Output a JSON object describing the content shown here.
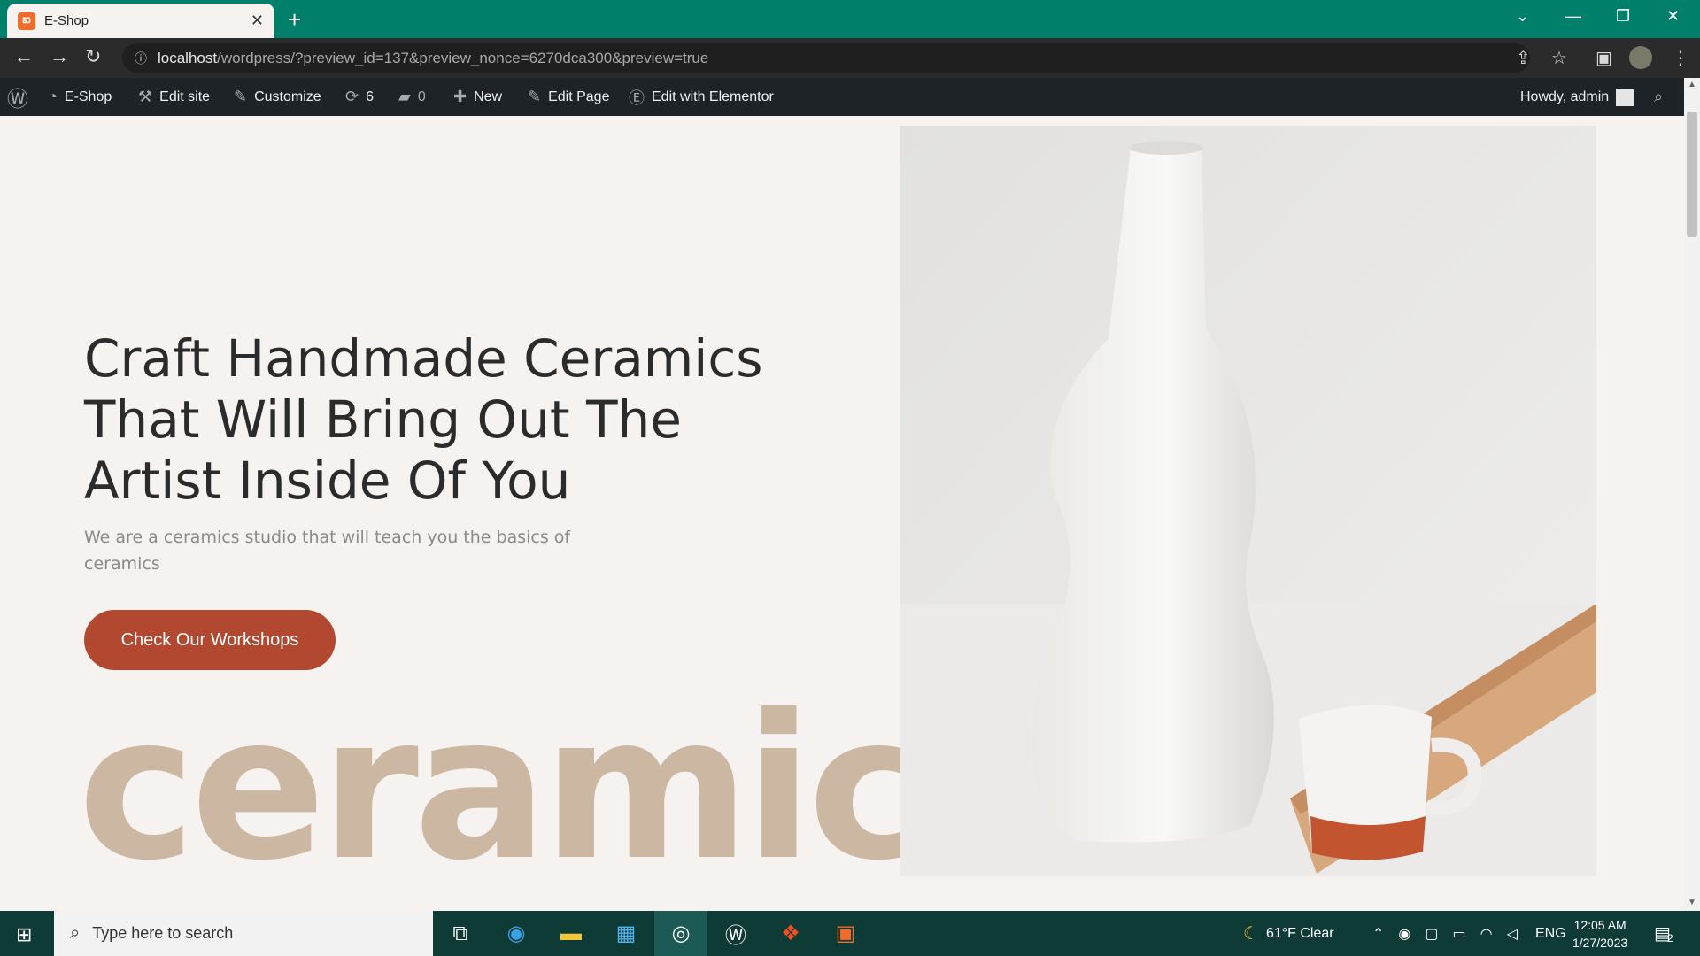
{
  "browser": {
    "tab_title": "E-Shop",
    "url_host": "localhost",
    "url_rest": "/wordpress/?preview_id=137&preview_nonce=6270dca300&preview=true"
  },
  "wpbar": {
    "site": "E-Shop",
    "edit_site": "Edit site",
    "customize": "Customize",
    "updates": "6",
    "comments": "0",
    "new": "New",
    "edit_page": "Edit Page",
    "elementor": "Edit with Elementor",
    "howdy": "Howdy, admin"
  },
  "hero": {
    "title": "Craft Handmade Ceramics That Will Bring Out The Artist Inside Of You",
    "subtitle": "We are a ceramics studio that will teach you the basics of ceramics",
    "cta": "Check Our Workshops",
    "big_word": "ceramic"
  },
  "taskbar": {
    "search_placeholder": "Type here to search",
    "weather": "61°F  Clear",
    "lang": "ENG",
    "time": "12:05 AM",
    "date": "1/27/2023",
    "notifications": "2"
  },
  "colors": {
    "tab_bar": "#00806b",
    "cta": "#b1482f",
    "big_word": "#cbb7a2",
    "page_bg": "#f5f2ef",
    "admin_bar": "#1d2327"
  }
}
